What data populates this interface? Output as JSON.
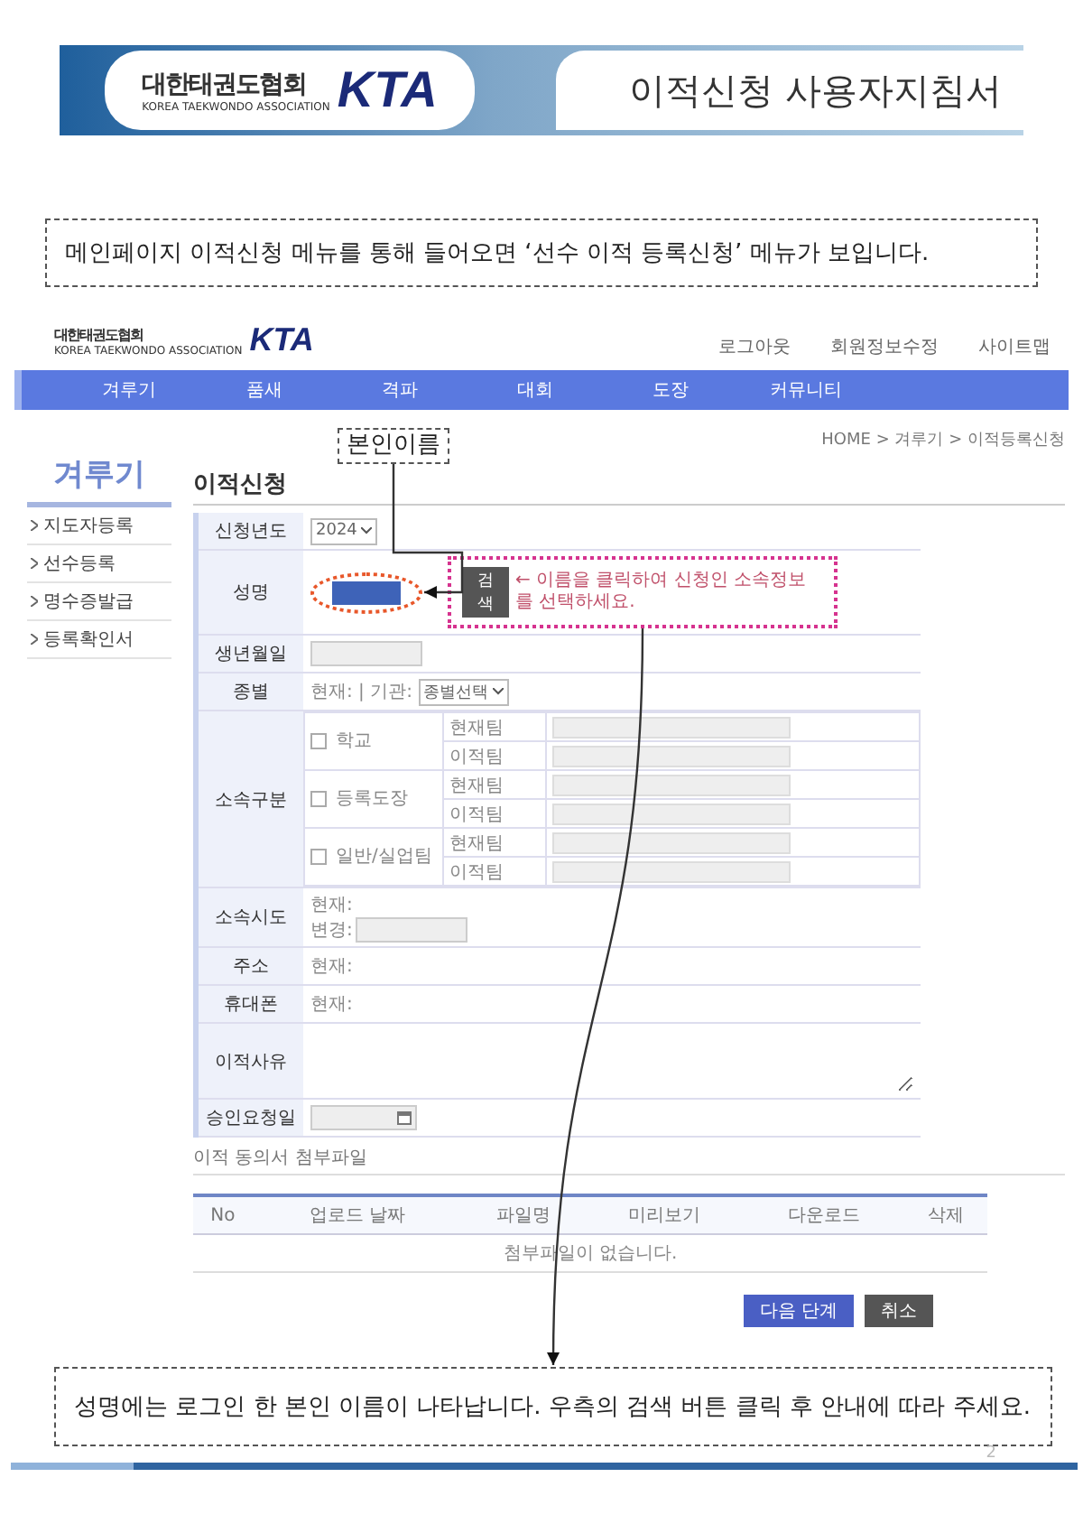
{
  "banner": {
    "org_name": "대한태권도협회",
    "org_name_en": "KOREA TAEKWONDO ASSOCIATION",
    "logo_text": "KTA",
    "title": "이적신청 사용자지침서"
  },
  "intro_note": "메인페이지 이적신청 메뉴를 통해 들어오면 ‘선수 이적 등록신청’ 메뉴가 보입니다.",
  "site": {
    "logo": {
      "org_name": "대한태권도협회",
      "org_name_en": "KOREA TAEKWONDO ASSOCIATION",
      "logo_text": "KTA"
    },
    "top_links": [
      "로그아웃",
      "회원정보수정",
      "사이트맵"
    ],
    "nav": [
      "겨루기",
      "품새",
      "격파",
      "대회",
      "도장",
      "커뮤니티"
    ],
    "sidebar": {
      "title": "겨루기",
      "items": [
        "지도자등록",
        "선수등록",
        "명수증발급",
        "등록확인서"
      ]
    },
    "breadcrumb": "HOME > 겨루기 > 이적등록신청",
    "name_annotation": "본인이름",
    "page_title": "이적신청",
    "form": [
      {
        "label": "신청년도",
        "kind": "select",
        "value": "2024"
      },
      {
        "label": "성명",
        "kind": "name",
        "button": "검색",
        "hint": "← 이름을 클릭하여 신청인 소속정보를 선택하세요."
      },
      {
        "label": "생년월일",
        "kind": "input"
      },
      {
        "label": "종별",
        "kind": "text_select",
        "text": "현재: | 기관:",
        "select": "종별선택"
      },
      {
        "label": "소속구분",
        "kind": "affiliation",
        "groups": [
          {
            "label": "학교",
            "checked": false,
            "fields": [
              "현재팀",
              "이적팀"
            ]
          },
          {
            "label": "등록도장",
            "checked": false,
            "fields": [
              "현재팀",
              "이적팀"
            ]
          },
          {
            "label": "일반/실업팀",
            "checked": false,
            "fields": [
              "현재팀",
              "이적팀"
            ]
          }
        ]
      },
      {
        "label": "소속시도",
        "kind": "current_change",
        "current": "현재:",
        "change": "변경:"
      },
      {
        "label": "주소",
        "kind": "text",
        "text": "현재:"
      },
      {
        "label": "휴대폰",
        "kind": "text",
        "text": "현재:"
      },
      {
        "label": "이적사유",
        "kind": "textarea"
      },
      {
        "label": "승인요청일",
        "kind": "date"
      }
    ],
    "attachments": {
      "title": "이적 동의서 첨부파일",
      "columns": [
        "No",
        "업로드 날짜",
        "파일명",
        "미리보기",
        "다운로드",
        "삭제"
      ],
      "empty_message": "첨부파일이 없습니다."
    },
    "buttons": [
      {
        "label": "다음 단계",
        "kind": "primary"
      },
      {
        "label": "취소",
        "kind": "secondary"
      }
    ]
  },
  "bottom_note": "성명에는 로그인 한 본인 이름이 나타납니다. 우측의 검색 버튼 클릭 후 안내에 따라 주세요.",
  "page_number": "2"
}
